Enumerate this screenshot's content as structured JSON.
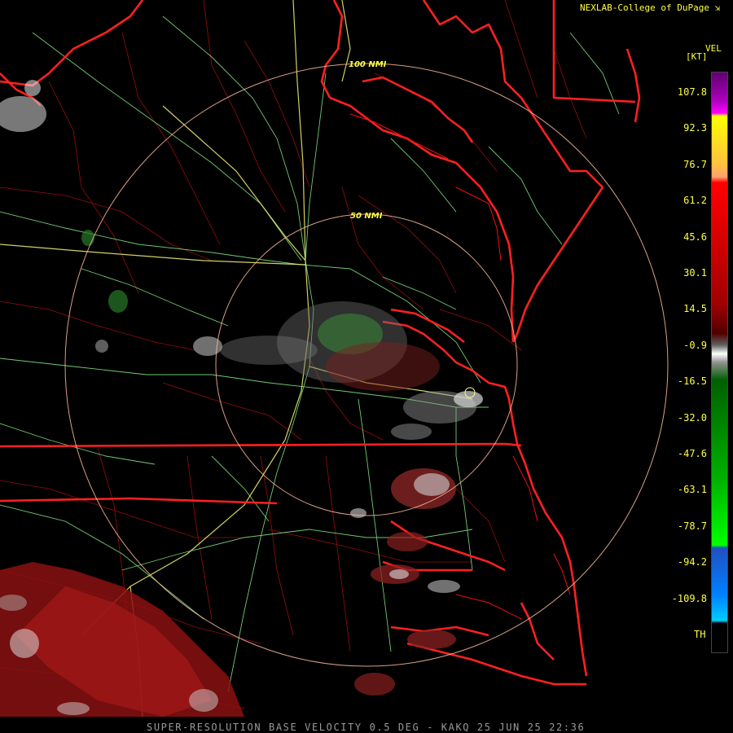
{
  "credit": "NEXLAB-College of DuPage",
  "range_rings": {
    "inner_label": "50 NMI",
    "outer_label": "100 NMI"
  },
  "legend": {
    "product": "VEL",
    "unit": "[KT]",
    "ticks": [
      "107.8",
      "92.3",
      "76.7",
      "61.2",
      "45.6",
      "30.1",
      "14.5",
      "-0.9",
      "-16.5",
      "-32.0",
      "-47.6",
      "-63.1",
      "-78.7",
      "-94.2",
      "-109.8"
    ],
    "th_label": "TH",
    "colors": [
      "#7a0080",
      "#ff00ff",
      "#ffff00",
      "#ffa060",
      "#ff0000",
      "#b00000",
      "#600000",
      "#ffffff",
      "#808080",
      "#00a000",
      "#00ff00",
      "#3070d0",
      "#00aaff"
    ]
  },
  "footer": "SUPER-RESOLUTION BASE VELOCITY 0.5 DEG - KAKQ 25 JUN 25 22:36",
  "colors": {
    "text": "#ffff44",
    "state_borders": "#ff2020",
    "county_lines": "#cc1010",
    "roads": "#88ff88",
    "highways": "#ffff80",
    "range_rings": "#ffbb99"
  }
}
